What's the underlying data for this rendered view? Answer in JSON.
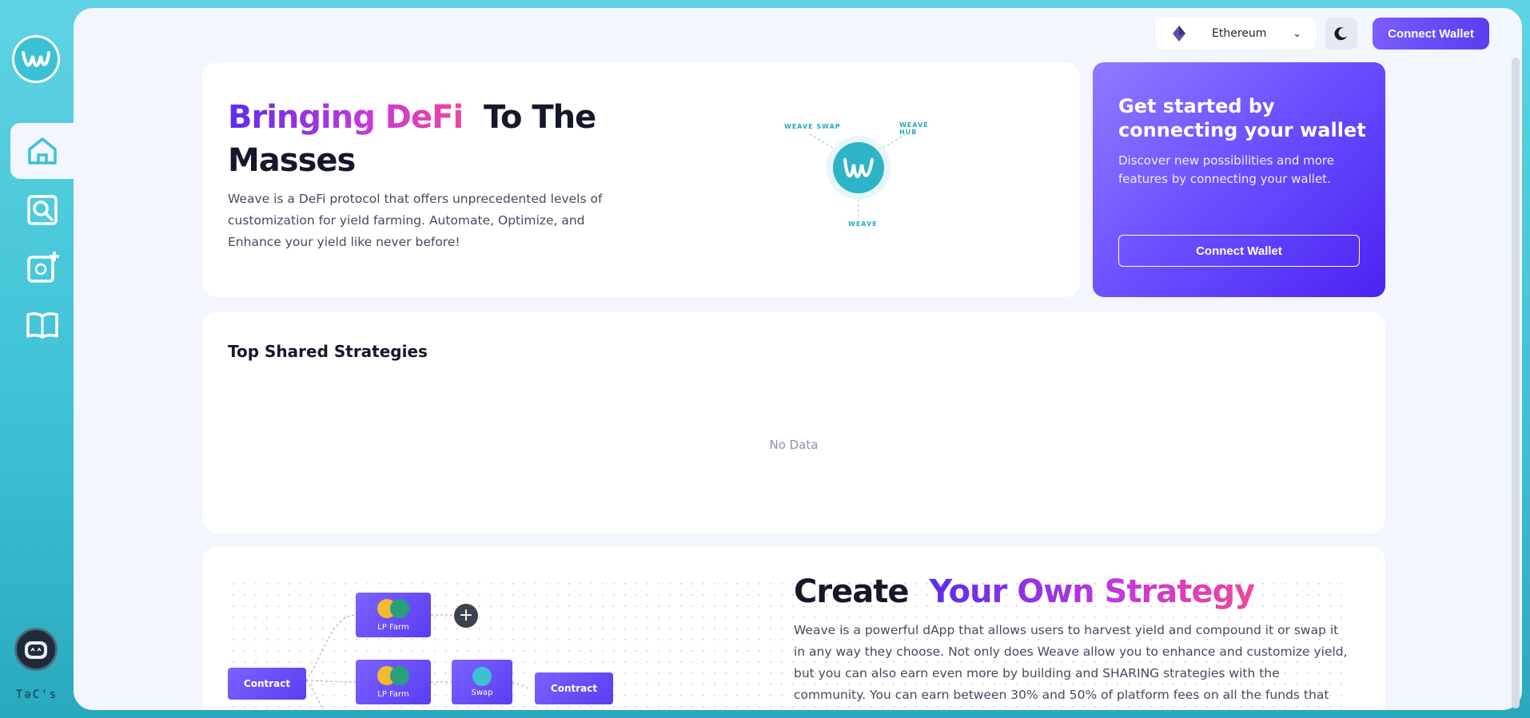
{
  "sidebar": {
    "logo_icon": "weave-logo-icon",
    "items": [
      {
        "icon": "home-icon",
        "active": true
      },
      {
        "icon": "search-icon",
        "active": false
      },
      {
        "icon": "add-strategy-icon",
        "active": false
      },
      {
        "icon": "book-icon",
        "active": false
      }
    ],
    "footer_label": "TəC's"
  },
  "topbar": {
    "network": "Ethereum",
    "theme_icon": "moon-icon",
    "connect_label": "Connect Wallet"
  },
  "hero": {
    "title_accent": "Bringing DeFi",
    "title_rest_1": "To The",
    "title_rest_2": "Masses",
    "description": "Weave is a DeFi protocol that offers unprecedented levels of customization for yield farming. Automate, Optimize, and Enhance your yield like never before!",
    "graphic": {
      "swap_label": "WEAVE SWAP",
      "hub_label": "WEAVE HUB",
      "bottom_label": "WEAVE"
    }
  },
  "promo": {
    "title": "Get started by connecting your wallet",
    "description": "Discover new possibilities and more features by connecting your wallet.",
    "button_label": "Connect Wallet"
  },
  "strategies": {
    "title": "Top Shared Strategies",
    "empty_text": "No Data"
  },
  "create": {
    "title_plain": "Create",
    "title_accent": "Your Own Strategy",
    "description": "Weave is a powerful dApp that allows users to harvest yield and compound it or swap it in any way they choose. Not only does Weave allow you to enhance and customize yield, but you can also earn even more by building and SHARING strategies with the community. You can earn between 30% and 50% of platform fees on all the funds that follow your strategy!",
    "flow": {
      "contract_label": "Contract",
      "lp_farm_label": "LP Farm",
      "swap_label": "Swap",
      "end_contract_label": "Contract"
    }
  },
  "colors": {
    "accent": "#6b4dff",
    "brand_teal": "#3cc1d4",
    "background": "#f3f5ff"
  }
}
